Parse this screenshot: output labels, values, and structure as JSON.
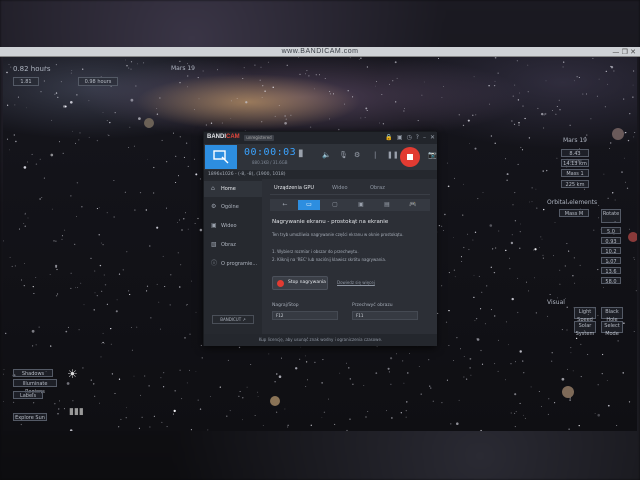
{
  "titlebar": {
    "text": "www.BANDICAM.com",
    "controls": "— ❐ ✕"
  },
  "stellarium": {
    "top_left_time": "0.82 hours",
    "top_left_sub": [
      "1.81",
      "0.98 hours"
    ],
    "top_center": "Mars 19",
    "right_panel": [
      "Mars 19",
      "8.43 hours",
      "14.13 km",
      "Mass 1",
      "0.46 km",
      "225 km"
    ],
    "right_section_title": "Orbital elements",
    "right_boxes": [
      "Mass M",
      "Rotate"
    ],
    "right_values": [
      "5.0",
      "0.93",
      "10.2",
      "1.07",
      "13.6",
      "58.0"
    ],
    "right_bottom": [
      "Visual",
      "Light\nSpeed",
      "Black\nHole",
      "Solar\nSystem",
      "Select\nMode"
    ],
    "bottom_left": [
      "Shadows",
      "Illuminate Regions",
      "Labels",
      "Explore Sun"
    ]
  },
  "bandicam": {
    "logo_a": "BANDI",
    "logo_b": "CAM",
    "badge": "unregistered",
    "timer": "00:00:03",
    "size": "880.1KB / 31.6GB",
    "target": "1896x1026 - (-8, -8), (1900, 1018)",
    "nav": [
      "Home",
      "Ogólne",
      "Wideo",
      "Obraz",
      "O programie..."
    ],
    "bandicut": "BANDICUT ↗",
    "tabs": [
      "Urządzenia GPU",
      "Wideo",
      "Obraz"
    ],
    "mode_icons": [
      "←",
      "▭",
      "▢",
      "▣",
      "▤",
      "🎮"
    ],
    "heading": "Nagrywanie ekranu - prostokąt na ekranie",
    "paragraph": "Ten tryb umożliwia nagrywanie części ekranu w oknie prostokątu.",
    "steps": [
      "1. Wybierz rozmiar i obszar do przechwytu.",
      "2. Kliknij na 'REC' lub naciśnij klawisz skrótu nagrywania."
    ],
    "stop_label": "Stop nagrywania",
    "more_link": "Dowiedz się więcej",
    "hotkeys": [
      {
        "label": "Nagraj/Stop",
        "value": "F12"
      },
      {
        "label": "Przechwyć obrazu",
        "value": "F11"
      }
    ],
    "bottom": "Kup licencję, aby usunąć znak wodny i ograniczenia czasowe."
  }
}
